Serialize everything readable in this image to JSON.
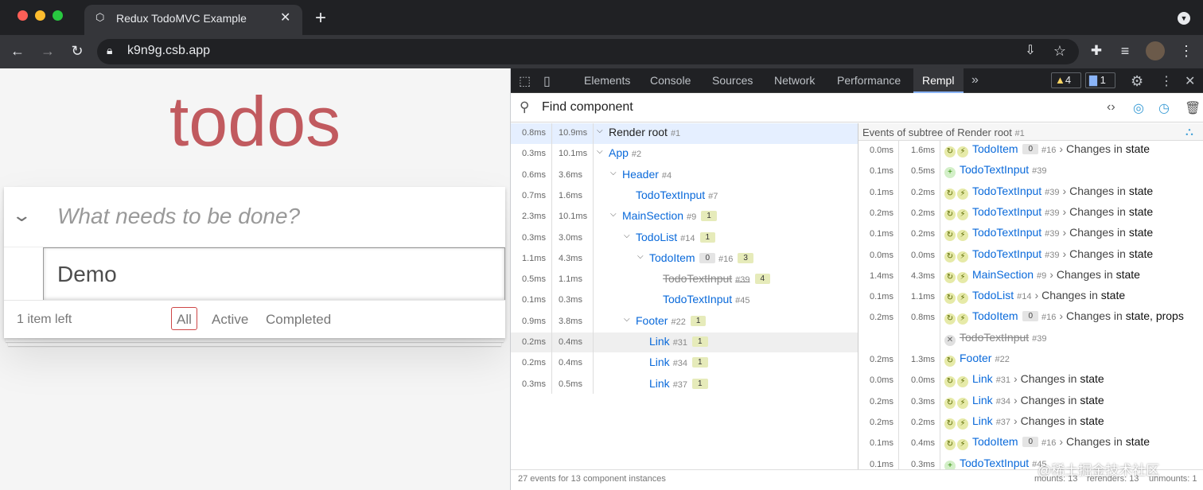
{
  "browser": {
    "tab_title": "Redux TodoMVC Example",
    "url": "k9n9g.csb.app"
  },
  "todo": {
    "title": "todos",
    "new_placeholder": "What needs to be done?",
    "edit_value": "Demo",
    "items_left": "1 item left",
    "filters": [
      "All",
      "Active",
      "Completed"
    ],
    "selected_filter": "All"
  },
  "devtools": {
    "tabs": [
      "Elements",
      "Console",
      "Sources",
      "Network",
      "Performance",
      "Rempl"
    ],
    "active_tab": "Rempl",
    "warnings": "4",
    "messages": "1",
    "find_placeholder": "Find component",
    "tree": [
      {
        "t1": "0.8ms",
        "t2": "10.9ms",
        "name": "Render root",
        "id": "#1",
        "depth": 0,
        "caret": true,
        "style": "root"
      },
      {
        "t1": "0.3ms",
        "t2": "10.1ms",
        "name": "App",
        "id": "#2",
        "depth": 0,
        "caret": true
      },
      {
        "t1": "0.6ms",
        "t2": "3.6ms",
        "name": "Header",
        "id": "#4",
        "depth": 1,
        "caret": true
      },
      {
        "t1": "0.7ms",
        "t2": "1.6ms",
        "name": "TodoTextInput",
        "id": "#7",
        "depth": 2
      },
      {
        "t1": "2.3ms",
        "t2": "10.1ms",
        "name": "MainSection",
        "id": "#9",
        "depth": 1,
        "caret": true,
        "badge": "1"
      },
      {
        "t1": "0.3ms",
        "t2": "3.0ms",
        "name": "TodoList",
        "id": "#14",
        "depth": 2,
        "caret": true,
        "badge": "1"
      },
      {
        "t1": "1.1ms",
        "t2": "4.3ms",
        "name": "TodoItem",
        "id": "#16",
        "depth": 3,
        "caret": true,
        "key": "0",
        "badge": "3"
      },
      {
        "t1": "0.5ms",
        "t2": "1.1ms",
        "name": "TodoTextInput",
        "id": "#39",
        "depth": 4,
        "style": "strike",
        "badge": "4"
      },
      {
        "t1": "0.1ms",
        "t2": "0.3ms",
        "name": "TodoTextInput",
        "id": "#45",
        "depth": 4
      },
      {
        "t1": "0.9ms",
        "t2": "3.8ms",
        "name": "Footer",
        "id": "#22",
        "depth": 2,
        "caret": true,
        "badge": "1"
      },
      {
        "t1": "0.2ms",
        "t2": "0.4ms",
        "name": "Link",
        "id": "#31",
        "depth": 3,
        "badge": "1"
      },
      {
        "t1": "0.2ms",
        "t2": "0.4ms",
        "name": "Link",
        "id": "#34",
        "depth": 3,
        "badge": "1"
      },
      {
        "t1": "0.3ms",
        "t2": "0.5ms",
        "name": "Link",
        "id": "#37",
        "depth": 3,
        "badge": "1"
      }
    ],
    "events_header": "Events of subtree of Render root",
    "events_header_id": "#1",
    "events": [
      {
        "t1": "0.0ms",
        "t2": "1.6ms",
        "type": "rerender",
        "indent": 1,
        "name": "TodoItem",
        "key": "0",
        "id": "#16",
        "change": "Changes in",
        "what": "state"
      },
      {
        "t1": "0.1ms",
        "t2": "0.5ms",
        "type": "mount",
        "indent": 0,
        "name": "TodoTextInput",
        "id": "#39"
      },
      {
        "t1": "0.1ms",
        "t2": "0.2ms",
        "type": "rerender",
        "indent": 1,
        "name": "TodoTextInput",
        "id": "#39",
        "change": "Changes in",
        "what": "state"
      },
      {
        "t1": "0.2ms",
        "t2": "0.2ms",
        "type": "rerender",
        "indent": 1,
        "name": "TodoTextInput",
        "id": "#39",
        "change": "Changes in",
        "what": "state"
      },
      {
        "t1": "0.1ms",
        "t2": "0.2ms",
        "type": "rerender",
        "indent": 1,
        "name": "TodoTextInput",
        "id": "#39",
        "change": "Changes in",
        "what": "state"
      },
      {
        "t1": "0.0ms",
        "t2": "0.0ms",
        "type": "rerender",
        "indent": 1,
        "name": "TodoTextInput",
        "id": "#39",
        "change": "Changes in",
        "what": "state"
      },
      {
        "t1": "1.4ms",
        "t2": "4.3ms",
        "type": "rerender",
        "indent": 1,
        "name": "MainSection",
        "id": "#9",
        "change": "Changes in",
        "what": "state"
      },
      {
        "t1": "0.1ms",
        "t2": "1.1ms",
        "type": "rerender",
        "indent": 1,
        "name": "TodoList",
        "id": "#14",
        "change": "Changes in",
        "what": "state"
      },
      {
        "t1": "0.2ms",
        "t2": "0.8ms",
        "type": "rerender",
        "indent": 1,
        "name": "TodoItem",
        "key": "0",
        "id": "#16",
        "change": "Changes in",
        "what": "state, props"
      },
      {
        "t1": "",
        "t2": "",
        "type": "unmount",
        "indent": 0,
        "name": "TodoTextInput",
        "id": "#39",
        "strike": true
      },
      {
        "t1": "0.2ms",
        "t2": "1.3ms",
        "type": "rerender-only",
        "indent": 0,
        "name": "Footer",
        "id": "#22"
      },
      {
        "t1": "0.0ms",
        "t2": "0.0ms",
        "type": "rerender",
        "indent": 1,
        "name": "Link",
        "id": "#31",
        "change": "Changes in",
        "what": "state"
      },
      {
        "t1": "0.2ms",
        "t2": "0.3ms",
        "type": "rerender",
        "indent": 1,
        "name": "Link",
        "id": "#34",
        "change": "Changes in",
        "what": "state"
      },
      {
        "t1": "0.2ms",
        "t2": "0.2ms",
        "type": "rerender",
        "indent": 1,
        "name": "Link",
        "id": "#37",
        "change": "Changes in",
        "what": "state"
      },
      {
        "t1": "0.1ms",
        "t2": "0.4ms",
        "type": "rerender",
        "indent": 1,
        "name": "TodoItem",
        "key": "0",
        "id": "#16",
        "change": "Changes in",
        "what": "state"
      },
      {
        "t1": "0.1ms",
        "t2": "0.3ms",
        "type": "mount",
        "indent": 0,
        "name": "TodoTextInput",
        "id": "#45"
      }
    ],
    "status": "27 events for 13 component instances",
    "mounts": "mounts: 13",
    "rerenders": "rerenders: 13",
    "unmounts": "unmounts: 1"
  },
  "watermark": "@稀土掘金技术社区"
}
